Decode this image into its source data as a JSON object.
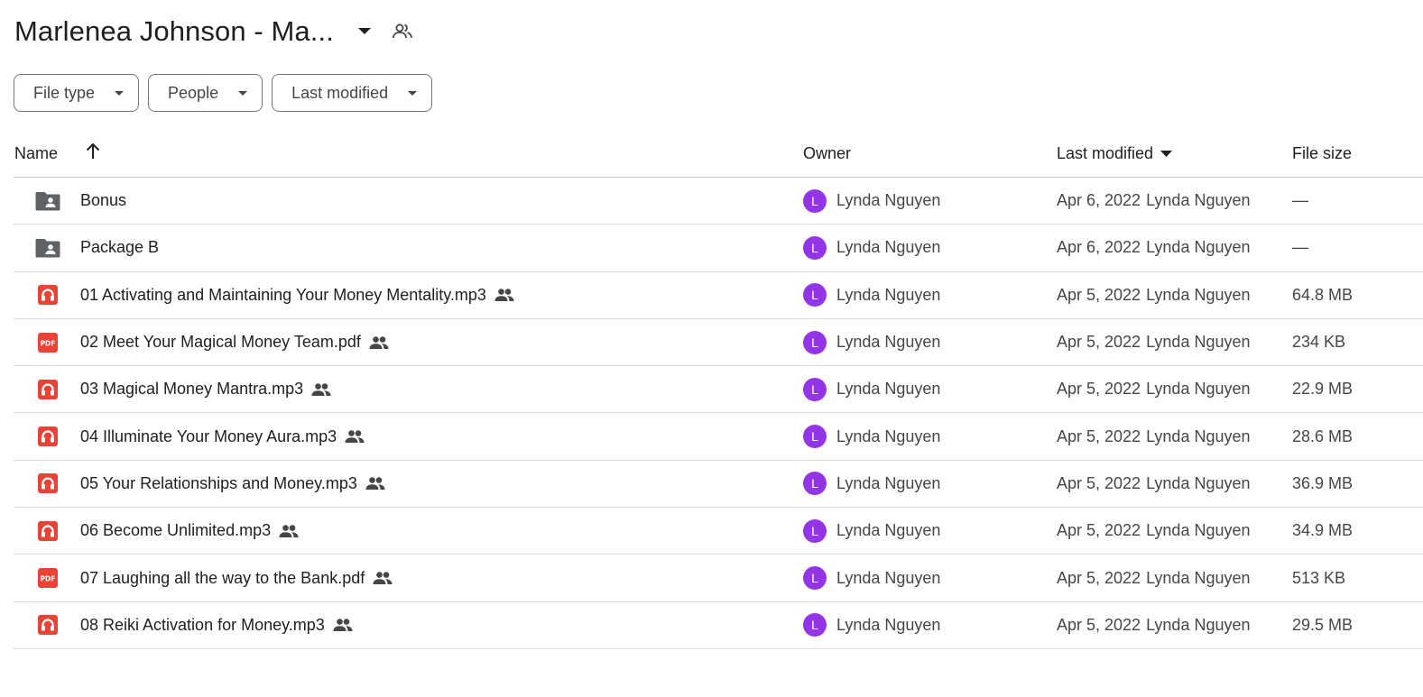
{
  "header": {
    "title": "Marlenea Johnson - Ma..."
  },
  "filters": [
    {
      "label": "File type"
    },
    {
      "label": "People"
    },
    {
      "label": "Last modified"
    }
  ],
  "table": {
    "columns": {
      "name": "Name",
      "owner": "Owner",
      "last_modified": "Last modified",
      "file_size": "File size"
    },
    "rows": [
      {
        "name": "Bonus",
        "type": "shared-folder-icon",
        "shared": false,
        "owner_initial": "L",
        "owner": "Lynda Nguyen",
        "date": "Apr 6, 2022",
        "modified_by": "Lynda Nguyen",
        "size": "—"
      },
      {
        "name": "Package B",
        "type": "shared-folder-icon",
        "shared": false,
        "owner_initial": "L",
        "owner": "Lynda Nguyen",
        "date": "Apr 6, 2022",
        "modified_by": "Lynda Nguyen",
        "size": "—"
      },
      {
        "name": "01 Activating and Maintaining Your Money Mentality.mp3",
        "type": "audio-file-icon",
        "shared": true,
        "owner_initial": "L",
        "owner": "Lynda Nguyen",
        "date": "Apr 5, 2022",
        "modified_by": "Lynda Nguyen",
        "size": "64.8 MB"
      },
      {
        "name": "02 Meet Your Magical Money Team.pdf",
        "type": "pdf-file-icon",
        "shared": true,
        "owner_initial": "L",
        "owner": "Lynda Nguyen",
        "date": "Apr 5, 2022",
        "modified_by": "Lynda Nguyen",
        "size": "234 KB"
      },
      {
        "name": "03 Magical Money Mantra.mp3",
        "type": "audio-file-icon",
        "shared": true,
        "owner_initial": "L",
        "owner": "Lynda Nguyen",
        "date": "Apr 5, 2022",
        "modified_by": "Lynda Nguyen",
        "size": "22.9 MB"
      },
      {
        "name": "04 Illuminate Your Money Aura.mp3",
        "type": "audio-file-icon",
        "shared": true,
        "owner_initial": "L",
        "owner": "Lynda Nguyen",
        "date": "Apr 5, 2022",
        "modified_by": "Lynda Nguyen",
        "size": "28.6 MB"
      },
      {
        "name": "05 Your Relationships and Money.mp3",
        "type": "audio-file-icon",
        "shared": true,
        "owner_initial": "L",
        "owner": "Lynda Nguyen",
        "date": "Apr 5, 2022",
        "modified_by": "Lynda Nguyen",
        "size": "36.9 MB"
      },
      {
        "name": "06 Become Unlimited.mp3",
        "type": "audio-file-icon",
        "shared": true,
        "owner_initial": "L",
        "owner": "Lynda Nguyen",
        "date": "Apr 5, 2022",
        "modified_by": "Lynda Nguyen",
        "size": "34.9 MB"
      },
      {
        "name": "07 Laughing all the way to the Bank.pdf",
        "type": "pdf-file-icon",
        "shared": true,
        "owner_initial": "L",
        "owner": "Lynda Nguyen",
        "date": "Apr 5, 2022",
        "modified_by": "Lynda Nguyen",
        "size": "513 KB"
      },
      {
        "name": "08 Reiki Activation for Money.mp3",
        "type": "audio-file-icon",
        "shared": true,
        "owner_initial": "L",
        "owner": "Lynda Nguyen",
        "date": "Apr 5, 2022",
        "modified_by": "Lynda Nguyen",
        "size": "29.5 MB"
      }
    ]
  },
  "colors": {
    "avatar": "#9334e6",
    "folder": "#5f6368",
    "file_red": "#ea4335"
  },
  "icons": {
    "title_caret": "caret-down-icon",
    "title_share": "people-outline-icon",
    "sort": "arrow-up-icon",
    "shared": "people-icon"
  }
}
